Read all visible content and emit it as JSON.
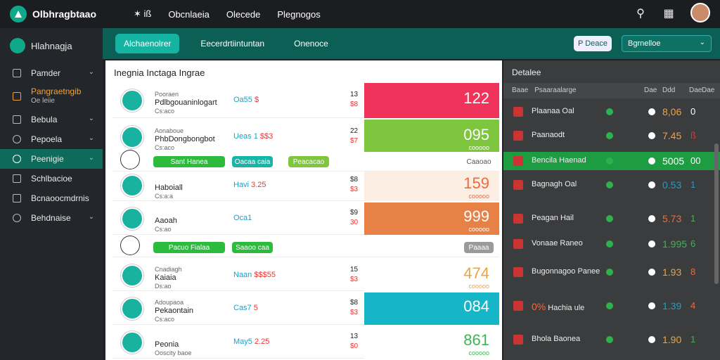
{
  "topbar": {
    "brand": "Olbhragbtaao",
    "icon_text": "✶ iß",
    "nav": [
      "Obcnlaeia",
      "Olecede",
      "Plegnogos"
    ]
  },
  "sidebar": {
    "title": "Hlahnagja",
    "items": [
      {
        "label": "Pamder",
        "chev": "⌄"
      },
      {
        "label": "Pangraetngib",
        "sub": "Oe leiie",
        "accent": "#f1a33a"
      },
      {
        "label": "Bebula",
        "chev": "⌄"
      },
      {
        "label": "Pepoela",
        "chev": "⌄"
      },
      {
        "label": "Peenigie",
        "chev": "⌄",
        "active": true
      },
      {
        "label": "Schlbacioe"
      },
      {
        "label": "Bcnaoocmdrnis"
      },
      {
        "label": "Behdnaise",
        "chev": "⌄"
      }
    ]
  },
  "tabs": [
    "Alchaenolrer",
    "Eecerdrtiintuntan",
    "Onenoce"
  ],
  "toolbar": {
    "button": "P  Deace",
    "select": "Bgrnelloe",
    "select_arrow": "⌄"
  },
  "main": {
    "title": "Inegnia Inctaga Ingrae",
    "rows": [
      {
        "name": "Pdlbgouaninlogart",
        "line1": "Pooraen",
        "line2": "Cs:aco",
        "mid": "Oa55",
        "mid_red": "$",
        "n1": "13",
        "n2": "$8",
        "big": "122",
        "bigsub": "",
        "color": "#f0335a"
      },
      {
        "name": "PhbDongbongbot",
        "line1": "Aonaboue",
        "line2": "Cs:aco",
        "mid": "Ueas  1",
        "mid_red": "$$3",
        "n1": "22",
        "n2": "$7",
        "big": "095",
        "bigsub": "cooooo",
        "color": "#7dc63e"
      },
      {
        "name": "Haboiall",
        "line1": "",
        "line2": "Cs:a:a",
        "mid": "Havi",
        "mid_red": "3.25",
        "n1": "$8",
        "n2": "$3",
        "big": "159",
        "bigsub": "cooooo",
        "color": "#fdeee3",
        "bigcolor": "#f06a3a"
      },
      {
        "name": "Aaoah",
        "line1": "",
        "line2": "Cs:ao",
        "mid": "Oca1",
        "mid_red": "",
        "n1": "$9",
        "n2": "30",
        "big": "999",
        "bigsub": "cooooo",
        "color": "#e88146"
      },
      {
        "name": "Kaiaia",
        "line1": "Cnadiagh",
        "line2": "Ds:ao",
        "mid": "Naan",
        "mid_red": "$$$55",
        "n1": "15",
        "n2": "$3",
        "big": "474",
        "bigsub": "cooooo",
        "color": "#fff",
        "bigcolor": "#f1a33a"
      },
      {
        "name": "Pekaontain",
        "line1": "Adoupaoa",
        "line2": "Cs:aco",
        "mid": "Cas7",
        "mid_red": "5",
        "n1": "$8",
        "n2": "$3",
        "big": "084",
        "bigsub": "",
        "color": "#17b5c8"
      },
      {
        "name": "Peonia",
        "line1": "",
        "line2": "Ooscity baoe",
        "mid": "May5",
        "mid_red": "2.25",
        "n1": "13",
        "n2": "$0",
        "big": "861",
        "bigsub": "cooooo",
        "color": "#fff",
        "bigcolor": "#3db552"
      }
    ],
    "pills1": [
      "Sant  Hanea",
      "Oacaa caia",
      "Peacacao"
    ],
    "pills1_right": "Caaoao",
    "pills2": [
      "Pacuo Fialaa",
      "Saaoo  caa"
    ],
    "pills2_right": "Paaaa"
  },
  "right": {
    "title": "Detalee",
    "head": {
      "a": "Baae",
      "b": "Psaaraalarge",
      "c": "Dae",
      "d": "Ddd",
      "e": "Dae",
      "f": "Dae"
    },
    "rows": [
      {
        "name": "Plaanaa Oal",
        "val": "8,06",
        "last": "0",
        "valcolor": "#f1a33a",
        "lastcolor": "#fff"
      },
      {
        "name": "Paanaodt",
        "val": "7.45",
        "last": "ß",
        "valcolor": "#f1a33a",
        "lastcolor": "#e33"
      },
      {
        "name": "Bencila Haenad",
        "val": "5005",
        "last": "00",
        "valcolor": "#fff",
        "lastcolor": "#fff",
        "hl": true
      },
      {
        "name": "Bagnagh Oal",
        "val": "0.53",
        "last": "1",
        "valcolor": "#19a0c8",
        "lastcolor": "#19a0c8"
      },
      {
        "name": "Peagan Hail",
        "val": "5.73",
        "last": "1",
        "valcolor": "#f06a3a",
        "lastcolor": "#3db552"
      },
      {
        "name": "Vonaae Raneo",
        "val": "1.995",
        "last": "6",
        "valcolor": "#3db552",
        "lastcolor": "#3db552"
      },
      {
        "name": "Bugonnagoo Panee",
        "val": "1.93",
        "last": "8",
        "valcolor": "#f1a33a",
        "lastcolor": "#f06a3a"
      },
      {
        "name": "Hachia ule",
        "val": "1.39",
        "last": "4",
        "valcolor": "#19a0c8",
        "lastcolor": "#f06a3a",
        "prefix": "0%"
      },
      {
        "name": "Bhola Baonea",
        "val": "1.90",
        "last": "1",
        "valcolor": "#f1a33a",
        "lastcolor": "#3db552"
      }
    ]
  }
}
